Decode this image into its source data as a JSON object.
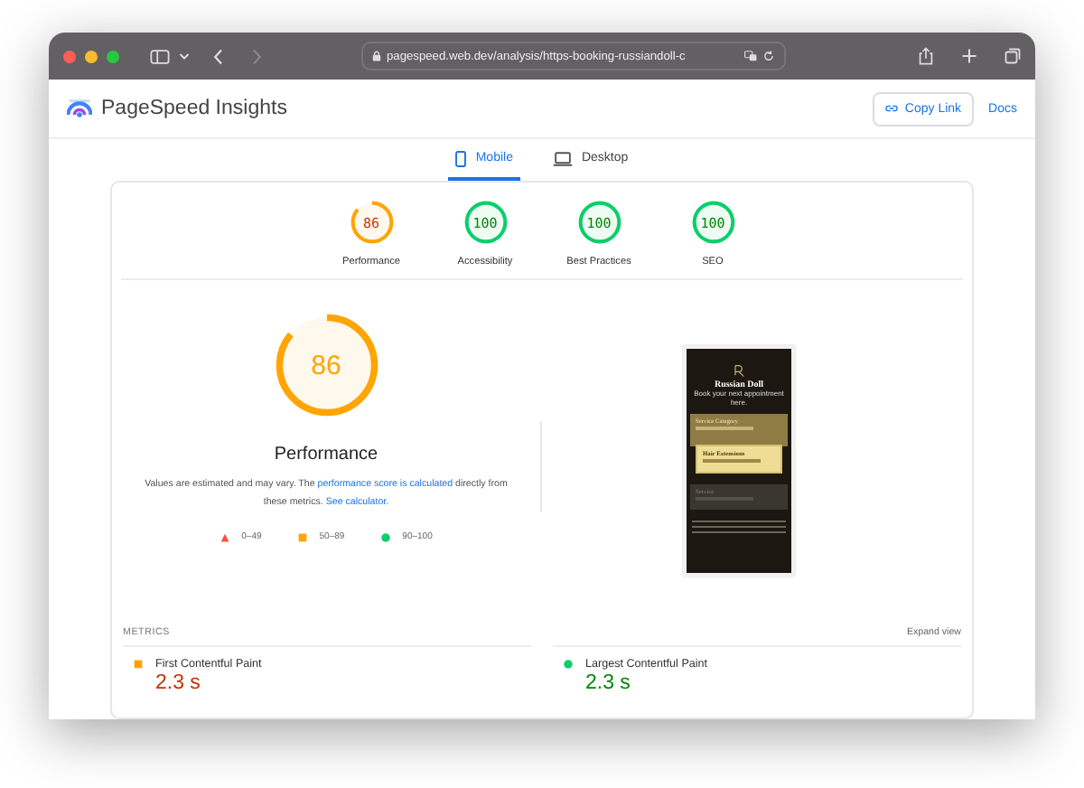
{
  "browser": {
    "url": "pagespeed.web.dev/analysis/https-booking-russiandoll-c"
  },
  "header": {
    "title": "PageSpeed Insights",
    "copy_link": "Copy Link",
    "docs": "Docs"
  },
  "device_tabs": [
    {
      "label": "Mobile",
      "kind": "phone",
      "selected": true
    },
    {
      "label": "Desktop",
      "kind": "laptop",
      "selected": false
    }
  ],
  "categories": [
    {
      "score": "86",
      "label": "Performance",
      "level": 0.86,
      "color": "#ffa400"
    },
    {
      "score": "100",
      "label": "Accessibility",
      "level": 1,
      "color": "#0cce6b"
    },
    {
      "score": "100",
      "label": "Best Practices",
      "level": 1,
      "color": "#0cce6b"
    },
    {
      "score": "100",
      "label": "SEO",
      "level": 1,
      "color": "#0cce6b"
    }
  ],
  "performance": {
    "score": "86",
    "level": 0.86,
    "color": "#ffa400",
    "title": "Performance",
    "note_start": "Values are estimated and may vary. The ",
    "note_link": "performance score is calculated",
    "note_mid": " directly from these metrics. ",
    "note_link_2": "See calculator."
  },
  "legend": [
    {
      "kind": "fail",
      "label": "0–49"
    },
    {
      "kind": "average",
      "label": "50–89"
    },
    {
      "kind": "pass",
      "label": "90–100"
    }
  ],
  "screenshot": {
    "brand": "Russian Doll",
    "tagline": "Book your next appointment here.",
    "items": [
      {
        "title": "Service Category",
        "kind": "open"
      },
      {
        "title": "Hair Extensions",
        "kind": "option"
      },
      {
        "title": "Service",
        "kind": "disabled"
      }
    ]
  },
  "metrics": {
    "heading": "METRICS",
    "expand": "Expand view",
    "items": [
      {
        "name": "First Contentful Paint",
        "value": "2.3 s",
        "kind": "square",
        "color": "#ffa400"
      },
      {
        "name": "Largest Contentful Paint",
        "value": "2.3 s",
        "kind": "circle",
        "color": "#0cce6b"
      }
    ]
  }
}
